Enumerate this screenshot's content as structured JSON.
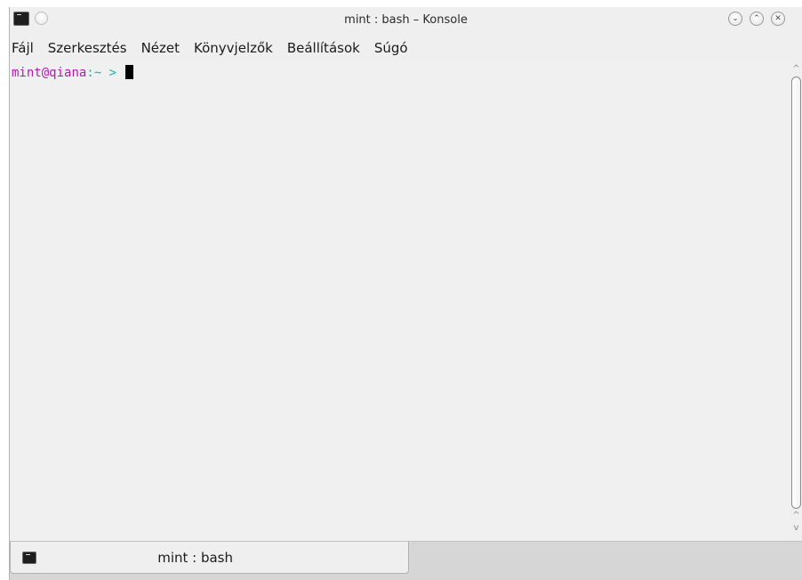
{
  "window": {
    "title": "mint : bash – Konsole"
  },
  "titlebar": {
    "icon": "terminal-icon",
    "sticky": "sticky-circle-icon",
    "minimize_icon": "chevron-down-icon",
    "maximize_icon": "chevron-up-icon",
    "close_icon": "close-icon",
    "min_glyph": "⌄",
    "max_glyph": "⌃",
    "close_glyph": "✕"
  },
  "menubar": {
    "items": [
      {
        "label": "Fájl"
      },
      {
        "label": "Szerkesztés"
      },
      {
        "label": "Nézet"
      },
      {
        "label": "Könyvjelzők"
      },
      {
        "label": "Beállítások"
      },
      {
        "label": "Súgó"
      }
    ]
  },
  "terminal": {
    "user": "mint",
    "at": "@",
    "host": "qiana",
    "sep": ":",
    "path": "~",
    "symbol": " >",
    "colors": {
      "user_host": "#b21ab2",
      "path": "#18b2b2",
      "background": "#f0f0f0",
      "cursor": "#000000"
    }
  },
  "scrollbar": {
    "up_glyph": "^",
    "down_glyph": "v"
  },
  "tabs": [
    {
      "label": "mint : bash",
      "icon": "terminal-icon"
    }
  ]
}
